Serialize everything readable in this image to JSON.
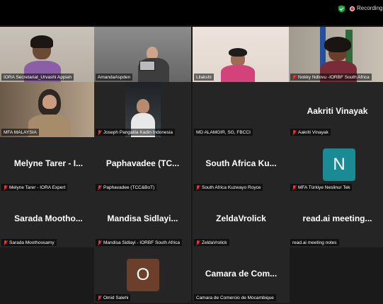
{
  "recording": {
    "label": "Recording..."
  },
  "tiles": [
    {
      "name": "IORA Secretariat_Urvashi Appiah",
      "muted": false
    },
    {
      "name": "AmandaAspden",
      "muted": false
    },
    {
      "name": "Lilakshi",
      "muted": false
    },
    {
      "name": "Nokky Ndlovu -IORBF South Africa",
      "muted": true
    },
    {
      "name": "MFA MALAYSIA",
      "muted": false
    },
    {
      "name": "Joseph Pangalila Kadin Indonesia",
      "muted": true
    },
    {
      "name": "MD ALAMGIR, SG, FBCCI",
      "muted": false
    },
    {
      "name": "Aakriti Vinayak",
      "muted": true,
      "display": "Aakriti Vinayak"
    },
    {
      "name": "Melyne Tarer - IORA Expert",
      "muted": true,
      "display": "Melyne Tarer - I..."
    },
    {
      "name": "Paphavadee (TCC&BoT)",
      "muted": true,
      "display": "Paphavadee (TC..."
    },
    {
      "name": "South Africa Kuzwayo Royce",
      "muted": true,
      "display": "South Africa Ku..."
    },
    {
      "name": "MFA Türkiye Neslinur Tek",
      "muted": true,
      "initial": "N"
    },
    {
      "name": "Sarada Moothoosamy",
      "muted": true,
      "display": "Sarada Mootho..."
    },
    {
      "name": "Mandisa Sidlayi - IORBF South Africa",
      "muted": true,
      "display": "Mandisa Sidlayi..."
    },
    {
      "name": "ZeldaVrolick",
      "muted": true,
      "display": "ZeldaVrolick"
    },
    {
      "name": "read.ai meeting notes",
      "muted": false,
      "display": "read.ai meeting..."
    },
    {
      "name": "Omid Salehi",
      "muted": true,
      "initial": "O"
    },
    {
      "name": "Camara de Comercio de Mocambique",
      "muted": false,
      "display": "Camara de Com..."
    }
  ],
  "colors": {
    "active_speaker": "#2ecc40",
    "avatar_n": "#1a8a94",
    "avatar_o": "#6b3f2a",
    "muted": "#e33"
  }
}
